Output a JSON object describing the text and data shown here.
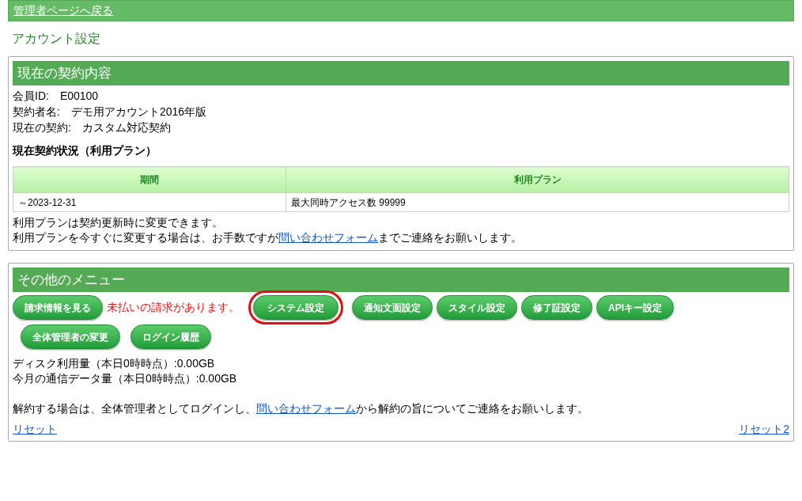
{
  "top_bar": {
    "back_link": "管理者ページへ戻る"
  },
  "page_title": "アカウント設定",
  "contract": {
    "heading": "現在の契約内容",
    "fields": [
      {
        "label": "会員ID:",
        "value": "E00100"
      },
      {
        "label": "契約者名:",
        "value": "デモ用アカウント2016年版"
      },
      {
        "label": "現在の契約:",
        "value": "カスタム対応契約"
      }
    ],
    "status_heading": "現在契約状況（利用プラン）",
    "table": {
      "columns": [
        "期間",
        "利用プラン"
      ],
      "rows": [
        [
          "～2023-12-31",
          "最大同時アクセス数 99999"
        ]
      ]
    },
    "notes": [
      {
        "before": "利用プランは契約更新時に変更できます。"
      },
      {
        "before": "利用プランを今すぐに変更する場合は、お手数ですが",
        "link": "問い合わせフォーム",
        "after": "までご連絡をお願いします。"
      }
    ]
  },
  "menu": {
    "heading": "その他のメニュー",
    "items": [
      {
        "kind": "button",
        "label": "請求情報を見る",
        "highlighted": false
      },
      {
        "kind": "notice",
        "label": "未払いの請求があります。"
      },
      {
        "kind": "button",
        "label": "システム設定",
        "highlighted": true
      },
      {
        "kind": "button",
        "label": "通知文面設定",
        "highlighted": false
      },
      {
        "kind": "button",
        "label": "スタイル設定",
        "highlighted": false
      },
      {
        "kind": "button",
        "label": "修了証設定",
        "highlighted": false
      },
      {
        "kind": "button",
        "label": "APIキー設定",
        "highlighted": false
      },
      {
        "kind": "button",
        "label": "全体管理者の変更",
        "highlighted": false
      },
      {
        "kind": "button",
        "label": "ログイン履歴",
        "highlighted": false
      }
    ],
    "usage": [
      "ディスク利用量（本日0時時点）:0.00GB",
      "今月の通信データ量（本日0時時点）:0.00GB"
    ],
    "cancel_note": {
      "before": "解約する場合は、全体管理者としてログインし、",
      "link": "問い合わせフォーム",
      "after": "から解約の旨についてご連絡をお願いします。"
    },
    "reset_link": "リセット",
    "reset2_link": "リセット2"
  }
}
